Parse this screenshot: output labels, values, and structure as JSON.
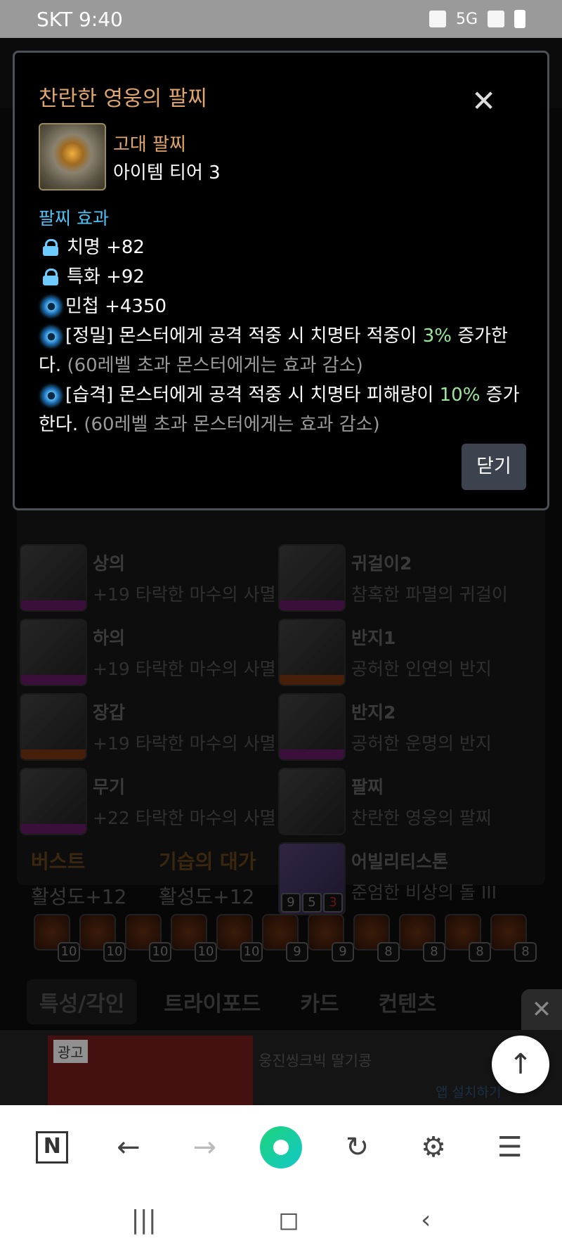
{
  "status_bar": {
    "carrier_time": "SKT 9:40",
    "network": "5G"
  },
  "modal": {
    "title": "찬란한 영웅의 팔찌",
    "grade": "고대 팔찌",
    "tier": "아이템 티어 3",
    "section": "팔찌 효과",
    "stat_crit": "치명 +82",
    "stat_spec": "특화 +92",
    "stat_swift": "민첩 +4350",
    "eff1_a": "[정밀] 몬스터에게 공격 적중 시 치명타 적중이 ",
    "eff1_pct": "3%",
    "eff1_b": " 증가한다. ",
    "eff1_note": "(60레벨 초과 몬스터에게는 효과 감소)",
    "eff2_a": "[습격] 몬스터에게 공격 적중 시 치명타 피해량이 ",
    "eff2_pct": "10%",
    "eff2_b": " 증가한다. ",
    "eff2_note": "(60레벨 초과 몬스터에게는 효과 감소)",
    "close_button": "닫기"
  },
  "equipment": [
    {
      "name": "상의",
      "sub": "+19 타락한 마수의 사멸",
      "bar": "#5a1a5a"
    },
    {
      "name": "귀걸이2",
      "sub": "참혹한 파멸의 귀걸이",
      "bar": "#5a1a5a"
    },
    {
      "name": "하의",
      "sub": "+19 타락한 마수의 사멸",
      "bar": "#5a1a5a"
    },
    {
      "name": "반지1",
      "sub": "공허한 인연의 반지",
      "bar": "#6a3010"
    },
    {
      "name": "장갑",
      "sub": "+19 타락한 마수의 사멸",
      "bar": "#6a3010"
    },
    {
      "name": "반지2",
      "sub": "공허한 운명의 반지",
      "bar": "#5a1a5a"
    },
    {
      "name": "무기",
      "sub": "+22 타락한 마수의 사멸",
      "bar": "#5a1a5a"
    },
    {
      "name": "팔찌",
      "sub": "찬란한 영웅의 팔찌",
      "bar": ""
    },
    {
      "name": "어빌리티스톤",
      "sub": "준엄한 비상의 돌 III",
      "bar": ""
    }
  ],
  "stone_levels": [
    "9",
    "5",
    "3"
  ],
  "engravings": [
    {
      "title": "버스트",
      "value": "활성도+12"
    },
    {
      "title": "기습의 대가",
      "value": "활성도+12"
    }
  ],
  "gem_levels": [
    "10",
    "10",
    "10",
    "10",
    "10",
    "9",
    "9",
    "8",
    "8",
    "8",
    "8"
  ],
  "tabs": [
    "특성/각인",
    "트라이포드",
    "카드",
    "컨텐츠"
  ],
  "ad": {
    "badge": "광고",
    "title": "웅진씽크빅 딸기콩",
    "install": "앱 설치하기"
  },
  "colors": {
    "grade": "#e0a56c",
    "section": "#4fc3f7",
    "highlight": "#9be89b",
    "note": "#9a9a9a"
  }
}
